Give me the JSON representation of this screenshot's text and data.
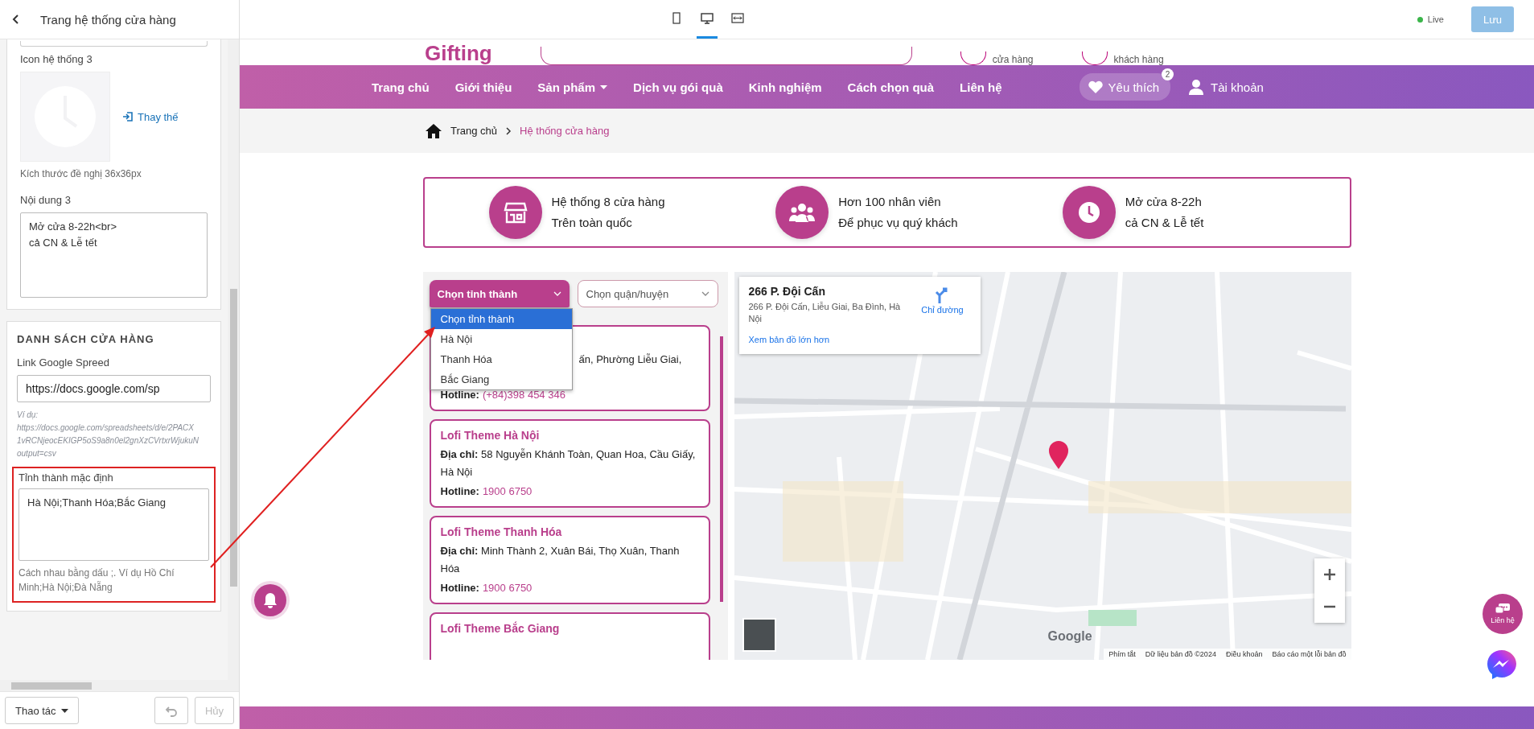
{
  "editor": {
    "title": "Trang hệ thống cửa hàng",
    "icon_field": {
      "label": "Icon hệ thống 3",
      "replace_link": "Thay thế",
      "hint": "Kích thước đề nghị 36x36px"
    },
    "content_field": {
      "label": "Nội dung 3",
      "value": "Mở cửa 8-22h<br>\ncả CN & Lễ tết"
    },
    "store_section": {
      "heading": "DANH SÁCH CỬA HÀNG",
      "link_label": "Link Google Spreed",
      "link_value": "https://docs.google.com/sp",
      "example_lines": [
        "Ví dụ:",
        "https://docs.google.com/spreadsheets/d/e/2PACX",
        "1vRCNjeocEKIGP5oS9a8n0el2gnXzCVrtxrWjukuN",
        "output=csv"
      ],
      "default_field": {
        "label": "Tỉnh thành mặc định",
        "value": "Hà Nội;Thanh Hóa;Bắc Giang",
        "hint": "Cách nhau bằng dấu ;. Ví dụ Hồ Chí Minh;Hà Nội;Đà Nẵng",
        "highlighted": true
      }
    },
    "actions_button": "Thao tác",
    "cancel_button": {
      "label": "Hủy",
      "disabled": true
    }
  },
  "toolbar": {
    "devices": [
      {
        "kind": "mobile",
        "selected": false
      },
      {
        "kind": "desktop",
        "selected": true
      },
      {
        "kind": "fullwidth",
        "selected": false
      }
    ],
    "status": "Live",
    "save_button": "Lưu"
  },
  "site_header": {
    "logo": "Gifting",
    "header_links": [
      "cửa hàng",
      "khách hàng"
    ]
  },
  "nav": {
    "items": [
      {
        "label": "Trang chủ",
        "has_menu": false
      },
      {
        "label": "Giới thiệu",
        "has_menu": false
      },
      {
        "label": "Sản phẩm",
        "has_menu": true
      },
      {
        "label": "Dịch vụ gói quà",
        "has_menu": false
      },
      {
        "label": "Kinh nghiệm",
        "has_menu": false
      },
      {
        "label": "Cách chọn quà",
        "has_menu": false
      },
      {
        "label": "Liên hệ",
        "has_menu": false
      }
    ],
    "wishlist": {
      "label": "Yêu thích",
      "count": "2"
    },
    "account": "Tài khoản"
  },
  "breadcrumb": [
    "Trang chủ",
    "Hệ thống cửa hàng"
  ],
  "features": [
    {
      "kind": "store",
      "line1": "Hệ thống 8 cửa hàng",
      "line2": "Trên toàn quốc"
    },
    {
      "kind": "people",
      "line1": "Hơn 100 nhân viên",
      "line2": "Để phục vụ quý khách"
    },
    {
      "kind": "clock",
      "line1": "Mở cửa 8-22h",
      "line2": "cả CN & Lễ tết"
    }
  ],
  "province_select": {
    "label": "Chọn tỉnh thành",
    "expanded": true,
    "options": [
      {
        "label": "Chọn tỉnh thành",
        "selected": true
      },
      {
        "label": "Hà Nội",
        "selected": false
      },
      {
        "label": "Thanh Hóa",
        "selected": false
      },
      {
        "label": "Bắc Giang",
        "selected": false
      }
    ]
  },
  "district_select": {
    "label": "Chọn quận/huyện"
  },
  "stores": [
    {
      "address": "ấn, Phường Liễu Giai,",
      "hotline_label": "Hotline:",
      "hotline": "(+84)398 454 346"
    },
    {
      "name": "Lofi Theme Hà Nội",
      "address": "**Địa chỉ:** 58 Nguyễn Khánh Toàn, Quan Hoa, Cầu Giấy, Hà Nội",
      "hotline_label": "Hotline:",
      "hotline": "1900 6750"
    },
    {
      "name": "Lofi Theme Thanh Hóa",
      "address": "**Địa chỉ:** Minh Thành 2, Xuân Bái, Thọ Xuân, Thanh Hóa",
      "hotline_label": "Hotline:",
      "hotline": "1900 6750"
    },
    {
      "name": "Lofi Theme Bắc Giang"
    }
  ],
  "map": {
    "place_title": "266 P. Đội Cấn",
    "place_address": "266 P. Đội Cấn, Liễu Giai, Ba Đình, Hà Nội",
    "directions": "Chỉ đường",
    "larger_map": "Xem bản đồ lớn hơn",
    "logo": "Google",
    "footer_links": [
      "Phím tắt",
      "Dữ liệu bản đồ ©2024",
      "Điều khoản",
      "Báo cáo một lỗi bản đồ"
    ]
  },
  "contact_button": "Liên hệ"
}
